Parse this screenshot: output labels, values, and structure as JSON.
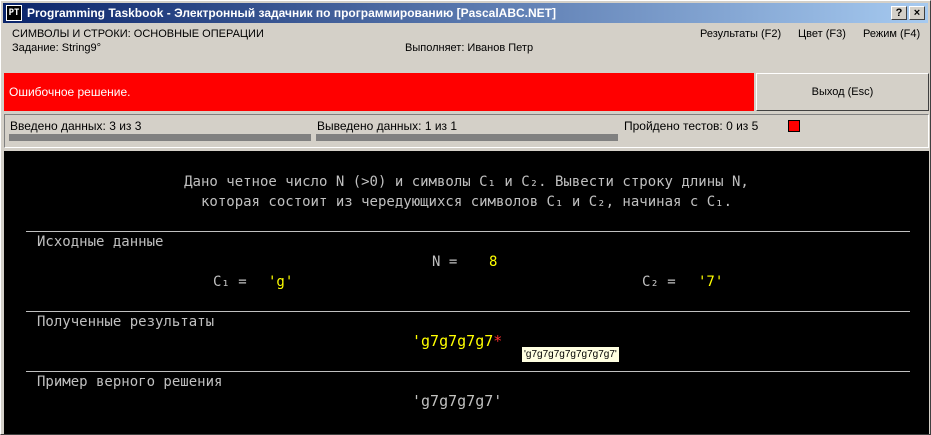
{
  "window": {
    "title": "Programming Taskbook - Электронный задачник по программированию [PascalABC.NET]",
    "icon_text": "PT",
    "help_label": "?",
    "close_label": "×"
  },
  "header": {
    "topic": "СИМВОЛЫ И СТРОКИ: ОСНОВНЫЕ ОПЕРАЦИИ",
    "task": "Задание: String9°",
    "student": "Выполняет: Иванов Петр",
    "menu": [
      "Результаты (F2)",
      "Цвет (F3)",
      "Режим (F4)"
    ]
  },
  "banner": {
    "message": "Ошибочное решение.",
    "color": "#ff0000",
    "exit_label": "Выход (Esc)"
  },
  "status": {
    "input_label": "Введено данных: 3 из 3",
    "output_label": "Выведено данных: 1 из 1",
    "tests_label": "Пройдено тестов: 0 из 5",
    "input_progress": 1.0,
    "output_progress": 1.0
  },
  "problem": {
    "line1": "Дано четное число N (>0) и символы C₁ и C₂. Вывести строку длины N,",
    "line2": "которая состоит из чередующихся символов C₁ и C₂, начиная с C₁."
  },
  "input_section": {
    "title": "Исходные данные",
    "n_label": "N =",
    "n_value": "8",
    "c1_label": "C₁ =",
    "c1_value": "'g'",
    "c2_label": "C₂ =",
    "c2_value": "'7'"
  },
  "result_section": {
    "title": "Полученные результаты",
    "value": "'g7g7g7g7",
    "error_marker": "*",
    "tooltip": "'g7g7g7g7g7g7g7g7'"
  },
  "example_section": {
    "title": "Пример верного решения",
    "value": "'g7g7g7g7'"
  }
}
